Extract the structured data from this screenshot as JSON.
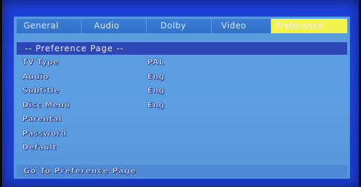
{
  "tabs": [
    "General",
    "Audio",
    "Dolby",
    "Video",
    "Preference"
  ],
  "active_tab": "Preference",
  "page_header": "-- Preference Page --",
  "rows": [
    {
      "label": "TV Type",
      "value": "PAL"
    },
    {
      "label": "Audio",
      "value": "Eng"
    },
    {
      "label": "Subtitle",
      "value": "Eng"
    },
    {
      "label": "Disc Menu",
      "value": "Eng"
    },
    {
      "label": "Parental",
      "value": ""
    },
    {
      "label": "Password",
      "value": ""
    },
    {
      "label": "Default",
      "value": ""
    }
  ],
  "footer_hint": "Go To Preference Page",
  "colors": {
    "screen_bg": "#1f45e0",
    "panel_bg": "#5a9be0",
    "tab_bg": "#3575cf",
    "active_tab_bg": "#f2f24a",
    "header_bg": "#2f47b6"
  }
}
